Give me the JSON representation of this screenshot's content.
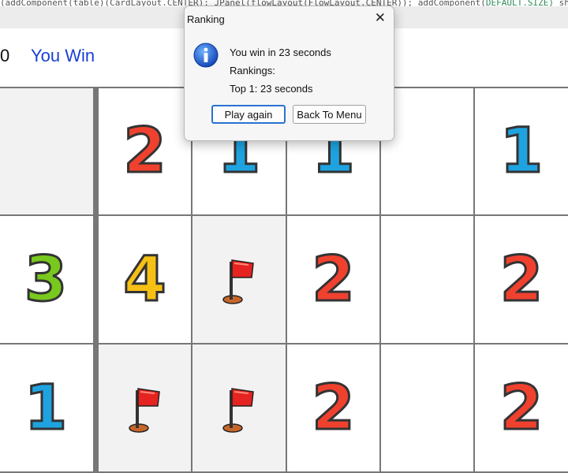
{
  "window": {
    "code_line_left": "(addComponent(table)(CardLayout.CENTER); JPanel(flowLayout(FlowLayout.CENTER)); addComponent(",
    "code_line_highlight": "DEFAULT.SIZE)",
    "code_line_right": " short(MAX VALUE));"
  },
  "header": {
    "score": "0",
    "status": "You Win",
    "status_color": "#1a3fd6"
  },
  "board": {
    "rows": [
      [
        {
          "type": "empty",
          "shade": true
        },
        {
          "type": "number",
          "value": "2"
        },
        {
          "type": "number",
          "value": "1"
        },
        {
          "type": "number",
          "value": "1"
        },
        {
          "type": "empty"
        },
        {
          "type": "number",
          "value": "1"
        }
      ],
      [
        {
          "type": "number",
          "value": "3"
        },
        {
          "type": "number",
          "value": "4"
        },
        {
          "type": "flag",
          "shade": true
        },
        {
          "type": "number",
          "value": "2"
        },
        {
          "type": "empty"
        },
        {
          "type": "number",
          "value": "2"
        }
      ],
      [
        {
          "type": "number",
          "value": "1"
        },
        {
          "type": "flag",
          "shade": true
        },
        {
          "type": "flag",
          "shade": true
        },
        {
          "type": "number",
          "value": "2"
        },
        {
          "type": "empty"
        },
        {
          "type": "number",
          "value": "2"
        }
      ]
    ],
    "number_colors": {
      "1": "#1fa3e0",
      "2": "#f0412f",
      "3": "#78c81e",
      "4": "#f6c015"
    },
    "flag_icon": "red-flag-icon"
  },
  "dialog": {
    "title": "Ranking",
    "close_symbol": "✕",
    "icon": "info-icon",
    "message_line1": "You win in 23 seconds",
    "message_line2": "Rankings:",
    "message_line3": "Top 1: 23 seconds",
    "play_again_label": "Play again",
    "back_to_menu_label": "Back To Menu"
  }
}
